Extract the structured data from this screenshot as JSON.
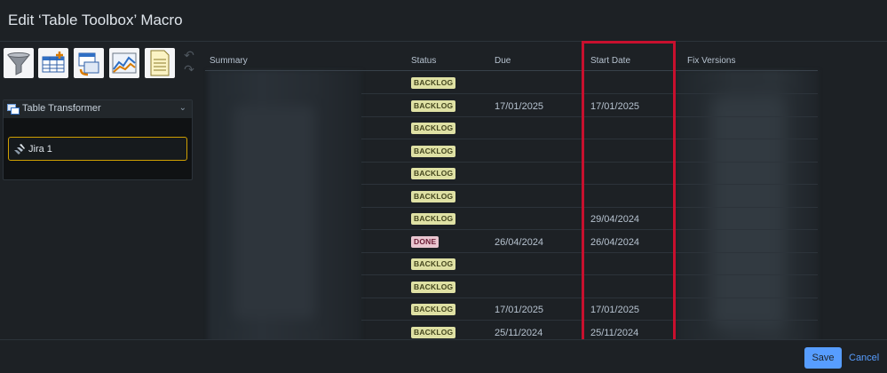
{
  "dialog": {
    "title": "Edit ‘Table Toolbox’ Macro"
  },
  "toolbar": {
    "tools": [
      {
        "icon": "filter-icon"
      },
      {
        "icon": "table-add-icon"
      },
      {
        "icon": "table-transform-icon"
      },
      {
        "icon": "chart-icon"
      },
      {
        "icon": "spreadsheet-icon"
      }
    ],
    "undo_icon": "undo-icon",
    "redo_icon": "redo-icon"
  },
  "panel": {
    "title": "Table Transformer",
    "item": "Jira 1"
  },
  "table": {
    "headers": {
      "summary": "Summary",
      "status": "Status",
      "due": "Due",
      "start_date": "Start Date",
      "fix_versions": "Fix Versions"
    },
    "rows": [
      {
        "status": "BACKLOG",
        "due": "",
        "start": ""
      },
      {
        "status": "BACKLOG",
        "due": "17/01/2025",
        "start": "17/01/2025"
      },
      {
        "status": "BACKLOG",
        "due": "",
        "start": ""
      },
      {
        "status": "BACKLOG",
        "due": "",
        "start": ""
      },
      {
        "status": "BACKLOG",
        "due": "",
        "start": ""
      },
      {
        "status": "BACKLOG",
        "due": "",
        "start": ""
      },
      {
        "status": "BACKLOG",
        "due": "",
        "start": "29/04/2024"
      },
      {
        "status": "DONE",
        "due": "26/04/2024",
        "start": "26/04/2024"
      },
      {
        "status": "BACKLOG",
        "due": "",
        "start": ""
      },
      {
        "status": "BACKLOG",
        "due": "",
        "start": ""
      },
      {
        "status": "BACKLOG",
        "due": "17/01/2025",
        "start": "17/01/2025"
      },
      {
        "status": "BACKLOG",
        "due": "25/11/2024",
        "start": "25/11/2024"
      }
    ]
  },
  "colors": {
    "highlight": "#c8102e",
    "accent": "#579dff",
    "selected_border": "#cf9f02"
  },
  "footer": {
    "save": "Save",
    "cancel": "Cancel"
  }
}
